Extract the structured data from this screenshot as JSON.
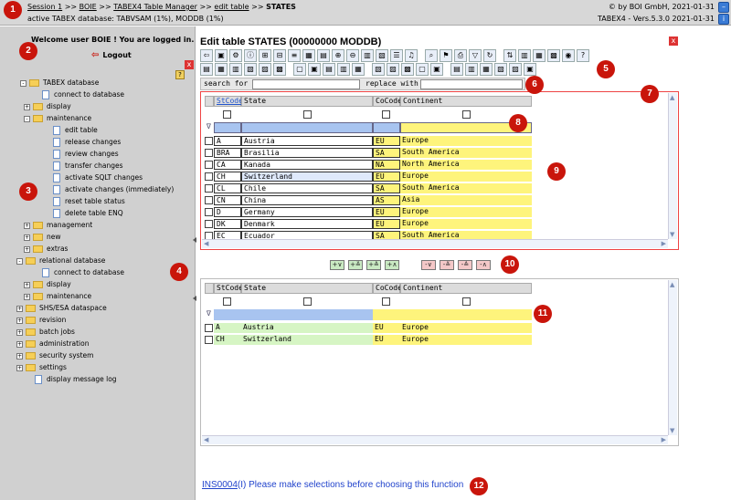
{
  "topbar": {
    "breadcrumb": [
      "Session 1",
      "BOIE",
      "TABEX4 Table Manager",
      "edit table"
    ],
    "breadcrumb_current": "STATES",
    "sep": ">>",
    "database_info": "active TABEX database: TABVSAM (1%), MODDB (1%)",
    "copyright": "© by BOI GmbH, 2021-01-31",
    "version": "TABEX4 - Vers.5.3.0 2021-01-31",
    "info_icon_text": "i"
  },
  "sidebar": {
    "welcome": "Welcome user BOIE ! You are logged in.",
    "logout": "Logout",
    "help_text": "?",
    "close_text": "x",
    "tree": [
      {
        "label": "TABEX database",
        "kind": "folder",
        "exp": "-"
      },
      {
        "label": "connect to database",
        "kind": "doc"
      },
      {
        "label": "display",
        "kind": "folder",
        "exp": "+"
      },
      {
        "label": "maintenance",
        "kind": "folder",
        "exp": "-"
      },
      {
        "label": "edit table",
        "kind": "doc"
      },
      {
        "label": "release changes",
        "kind": "doc"
      },
      {
        "label": "review changes",
        "kind": "doc"
      },
      {
        "label": "transfer changes",
        "kind": "doc"
      },
      {
        "label": "activate SQLT changes",
        "kind": "doc"
      },
      {
        "label": "activate changes (immediately)",
        "kind": "doc"
      },
      {
        "label": "reset table status",
        "kind": "doc"
      },
      {
        "label": "delete table ENQ",
        "kind": "doc"
      },
      {
        "label": "management",
        "kind": "folder",
        "exp": "+"
      },
      {
        "label": "new",
        "kind": "folder",
        "exp": "+"
      },
      {
        "label": "extras",
        "kind": "folder",
        "exp": "+"
      },
      {
        "label": "relational database",
        "kind": "folder",
        "exp": "-"
      },
      {
        "label": "connect to database",
        "kind": "doc"
      },
      {
        "label": "display",
        "kind": "folder",
        "exp": "+"
      },
      {
        "label": "maintenance",
        "kind": "folder",
        "exp": "+"
      },
      {
        "label": "SHS/ESA dataspace",
        "kind": "folder",
        "exp": "+"
      },
      {
        "label": "revision",
        "kind": "folder",
        "exp": "+"
      },
      {
        "label": "batch jobs",
        "kind": "folder",
        "exp": "+"
      },
      {
        "label": "administration",
        "kind": "folder",
        "exp": "+"
      },
      {
        "label": "security system",
        "kind": "folder",
        "exp": "+"
      },
      {
        "label": "settings",
        "kind": "folder",
        "exp": "+"
      },
      {
        "label": "display message log",
        "kind": "doc"
      }
    ]
  },
  "main": {
    "title": "Edit table STATES (00000000 MODDB)",
    "search_label": "search for",
    "replace_label": "replace with",
    "columns": [
      "StCode",
      "State",
      "CoCode",
      "Continent"
    ],
    "filter_symbol": "∇",
    "rows": [
      [
        "A",
        "Austria",
        "EU",
        "Europe"
      ],
      [
        "BRA",
        "Brasilia",
        "SA",
        "South America"
      ],
      [
        "CA",
        "Kanada",
        "NA",
        "North America"
      ],
      [
        "CH",
        "Switzerland",
        "EU",
        "Europe"
      ],
      [
        "CL",
        "Chile",
        "SA",
        "South America"
      ],
      [
        "CN",
        "China",
        "AS",
        "Asia"
      ],
      [
        "D",
        "Germany",
        "EU",
        "Europe"
      ],
      [
        "DK",
        "Denmark",
        "EU",
        "Europe"
      ],
      [
        "EC",
        "Ecuador",
        "SA",
        "South America"
      ]
    ],
    "selected_rows": [
      [
        "A",
        "Austria",
        "EU",
        "Europe"
      ],
      [
        "CH",
        "Switzerland",
        "EU",
        "Europe"
      ]
    ],
    "move_buttons": [
      "+∨",
      "+≚",
      "+≙",
      "+∧",
      "-∨",
      "-≚",
      "-≙",
      "-∧"
    ],
    "message_code": "INS0004",
    "message_text": "(I) Please make selections before choosing this function"
  },
  "badges": [
    "1",
    "2",
    "3",
    "4",
    "5",
    "6",
    "7",
    "8",
    "9",
    "10",
    "11",
    "12"
  ],
  "colors": {
    "badge": "#c9150b",
    "sidebar_bg": "#d0d0d0",
    "yellow_cell": "#fef47c",
    "green_cell": "#d6f5c4",
    "filter_blue": "#a8c4f0",
    "link_blue": "#2244cc"
  }
}
